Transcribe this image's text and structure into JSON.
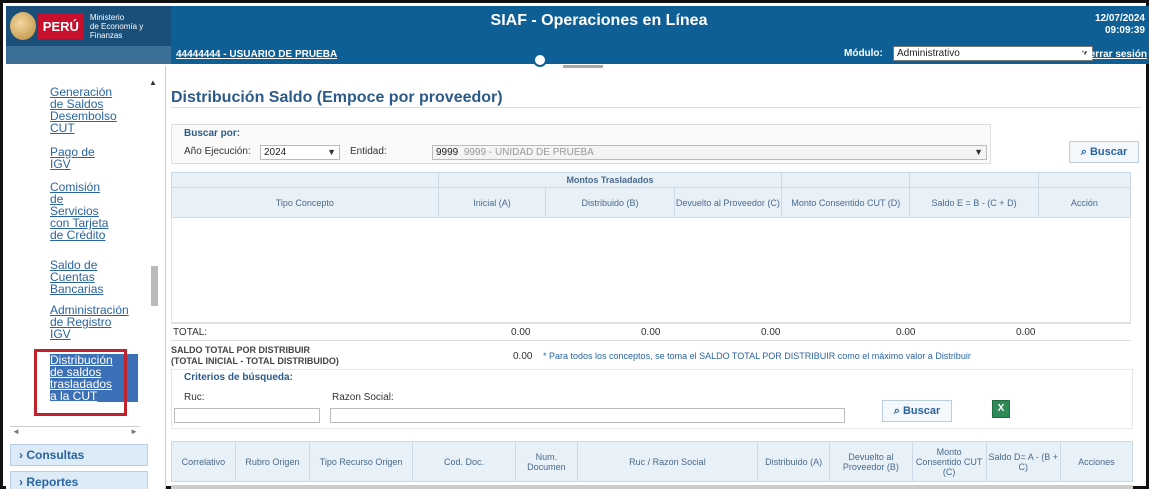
{
  "header": {
    "logo_peru": "PERÚ",
    "logo_ministry_line1": "Ministerio",
    "logo_ministry_line2": "de Economía y Finanzas",
    "system_title": "SIAF - Operaciones en Línea",
    "user_link": "44444444 - USUARIO DE PRUEBA",
    "modulo_label": "Módulo:",
    "modulo_value": "Administrativo",
    "date": "12/07/2024",
    "time": "09:09:39",
    "logout": "Cerrar sesión"
  },
  "sidebar": {
    "items": [
      {
        "label": "Generación de Saldos Desembolso CUT",
        "lines": [
          "Generación",
          "de Saldos",
          "Desembolso",
          "CUT"
        ]
      },
      {
        "label": "Pago de IGV",
        "lines": [
          "Pago de",
          "IGV"
        ]
      },
      {
        "label": "Comisión de Servicios con Tarjeta de Crédito",
        "lines": [
          "Comisión",
          "de",
          "Servicios",
          "con Tarjeta",
          "de Crédito"
        ]
      },
      {
        "label": "Saldo de Cuentas Bancarias",
        "lines": [
          "Saldo de",
          "Cuentas",
          "Bancarias"
        ]
      },
      {
        "label": "Administración de Registro IGV",
        "lines": [
          "Administración",
          "de Registro",
          "IGV"
        ]
      },
      {
        "label": "Distribución de saldos trasladados a la CUT",
        "lines": [
          "Distribución",
          "de saldos",
          "trasladados",
          "a la CUT"
        ]
      }
    ],
    "menus": [
      "Consultas",
      "Reportes"
    ]
  },
  "main": {
    "title": "Distribución Saldo (Empoce por proveedor)",
    "search": {
      "section_label": "Buscar por:",
      "year_label": "Año Ejecución:",
      "year_value": "2024",
      "entity_label": "Entidad:",
      "entity_code": "9999",
      "entity_name": "9999 - UNIDAD DE PRUEBA",
      "button": "Buscar"
    },
    "table1": {
      "group_header": "Montos Trasladados",
      "headers": [
        "Tipo Concepto",
        "Inicial (A)",
        "Distribuido (B)",
        "Devuelto al Proveedor (C)",
        "Monto Consentido CUT (D)",
        "Saldo E = B - (C + D)",
        "Acción"
      ],
      "total_label": "TOTAL:",
      "totals": [
        "0.00",
        "0.00",
        "0.00",
        "0.00",
        "0.00"
      ]
    },
    "saldo": {
      "label_line1": "SALDO TOTAL POR DISTRIBUIR",
      "label_line2": "(TOTAL INICIAL - TOTAL DISTRIBUIDO)",
      "value": "0.00",
      "note": "* Para todos los conceptos, se toma el SALDO TOTAL POR DISTRIBUIR como el máximo valor a Distribuir"
    },
    "criteria": {
      "label": "Criterios de búsqueda:",
      "ruc_label": "Ruc:",
      "razon_label": "Razon Social:",
      "button": "Buscar"
    },
    "table2": {
      "headers": [
        "Correlativo",
        "Rubro Origen",
        "Tipo Recurso Origen",
        "Cod. Doc.",
        "Num. Documen",
        "Ruc / Razon Social",
        "Distribuido (A)",
        "Devuelto al Proveedor (B)",
        "Monto Consentido CUT (C)",
        "Saldo D= A - (B + C)",
        "Acciones"
      ]
    }
  },
  "colors": {
    "header_bg": "#0f5f97",
    "accent": "#2c5a8a",
    "highlight_border": "#c0232b"
  }
}
